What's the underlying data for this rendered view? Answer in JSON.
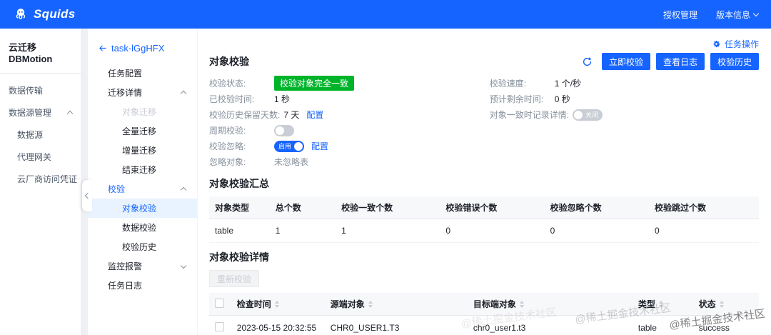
{
  "topbar": {
    "brand": "Squids",
    "nav": [
      {
        "label": "授权管理"
      },
      {
        "label": "版本信息"
      }
    ]
  },
  "sidebar": {
    "title": "云迁移 DBMotion",
    "items": [
      {
        "label": "数据传输"
      },
      {
        "label": "数据源管理"
      },
      {
        "label": "数据源"
      },
      {
        "label": "代理网关"
      },
      {
        "label": "云厂商访问凭证"
      }
    ]
  },
  "tasknav": {
    "back_label": "task-lGgHFX",
    "task_config": "任务配置",
    "migration_detail": "迁移详情",
    "migration_children": [
      {
        "label": "对象迁移"
      },
      {
        "label": "全量迁移"
      },
      {
        "label": "增量迁移"
      },
      {
        "label": "结束迁移"
      }
    ],
    "verification": "校验",
    "verification_children": [
      {
        "label": "对象校验"
      },
      {
        "label": "数据校验"
      },
      {
        "label": "校验历史"
      }
    ],
    "monitor_alarm": "监控报警",
    "task_log": "任务日志"
  },
  "main": {
    "task_ops": "任务操作",
    "title": "对象校验",
    "toolbar": {
      "verify_now": "立即校验",
      "view_log": "查看日志",
      "verify_history": "校验历史"
    },
    "fields": {
      "status": {
        "label": "校验状态:",
        "value": "校验对象完全一致"
      },
      "speed": {
        "label": "校验速度:",
        "value": "1 个/秒"
      },
      "verified_time": {
        "label": "已校验时间:",
        "value": "1 秒"
      },
      "remaining_time": {
        "label": "预计剩余时间:",
        "value": "0 秒"
      },
      "history_days": {
        "label": "校验历史保留天数:",
        "value": "7 天",
        "config": "配置"
      },
      "record_detail": {
        "label": "对象一致时记录详情:",
        "switch_text": "关闭"
      },
      "cycle_verify": {
        "label": "周期校验:"
      },
      "ignore": {
        "label": "校验忽略:",
        "switch_text": "启用",
        "config": "配置"
      },
      "ignored_objects": {
        "label": "忽略对象:",
        "value": "未忽略表"
      }
    },
    "summary": {
      "title": "对象校验汇总",
      "headers": [
        "对象类型",
        "总个数",
        "校验一致个数",
        "校验错误个数",
        "校验忽略个数",
        "校验跳过个数"
      ],
      "row": [
        "table",
        "1",
        "1",
        "0",
        "0",
        "0"
      ]
    },
    "details": {
      "title": "对象校验详情",
      "reverify": "重新校验",
      "headers": [
        "检查时间",
        "源端对象",
        "目标端对象",
        "类型",
        "状态"
      ],
      "row": [
        "2023-05-15 20:32:55",
        "CHR0_USER1.T3",
        "chr0_user1.t3",
        "table",
        "success"
      ]
    }
  },
  "watermark": "@稀土掘金技术社区",
  "colors": {
    "primary": "#1664ff",
    "success": "#00b42a",
    "active_bg": "#e8f3ff"
  }
}
